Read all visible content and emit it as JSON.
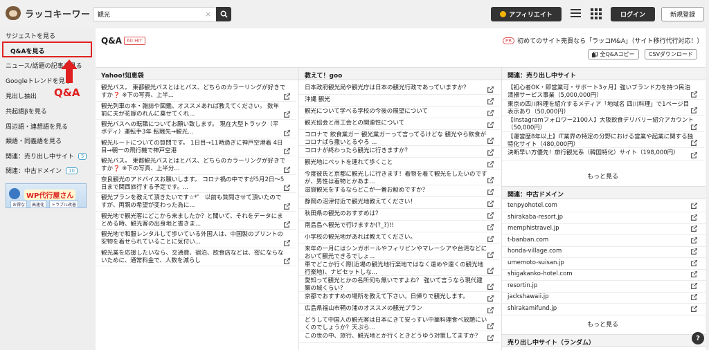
{
  "header": {
    "logo_text": "ラッコキーワード",
    "search_value": "観光",
    "search_clear": "×",
    "affiliate_label": "アフィリエイト",
    "login_label": "ログイン",
    "register_label": "新規登録"
  },
  "sidebar": {
    "items": [
      {
        "label": "サジェストを見る"
      },
      {
        "label": "Q&Aを見る"
      },
      {
        "label": "ニュース/話題の記事を見る"
      },
      {
        "label": "Googleトレンドを見る"
      },
      {
        "label": "見出し抽出"
      },
      {
        "label": "共起語βを見る"
      },
      {
        "label": "周辺語・連想語を見る"
      },
      {
        "label": "類語・同義語を見る"
      },
      {
        "label": "関連：売り出し中サイト",
        "badge": "5"
      },
      {
        "label": "関連：中古ドメイン",
        "badge": "10"
      }
    ],
    "annotation": "Q&A",
    "banner": {
      "title": "WP代行屋さん",
      "chips": [
        "お得な",
        "高速化",
        "トラブル改善"
      ]
    }
  },
  "main": {
    "title": "Q&A",
    "hit_badge": "60 HIT",
    "pr_badge": "PR",
    "pr_text": "初めてのサイト売買なら「ラッコM&A」（サイト移行代行対応！）",
    "copy_label": "全Q&Aコピー",
    "csv_label": "CSVダウンロード",
    "columns": [
      {
        "title": "Yahoo!知恵袋",
        "items": [
          [
            "観光バス。 東都観光バスとはとバス、どちらのカラーリングが好きで",
            "すか❓ ※下の写真、上半..."
          ],
          [
            "観光列車の本・雑誌や図鑑、オススメあれば教えてください。 数年",
            "前に夫が花嫁のれんに乗せてくれ..."
          ],
          [
            "観光バスへの転職についてお願い致します。 現在大型トラック（平",
            "ボディ）運転手3年 転職先→観光..."
          ],
          [
            "観光ルートについての質問です。 1日目→11時過ぎに神戸空港着 4日",
            "目→朝一の飛行機で神戸空港"
          ],
          [
            "観光バス。 東都観光バスとはとバス、どちらのカラーリングが好きで",
            "すか❓ ※下の写真、上半分..."
          ],
          [
            "奈良観光のアドバイスお願いします。 コロナ禍の中ですが5月2日〜5",
            "日まで関西旅行する予定です。..."
          ],
          [
            "観光プランを教えて頂きたいです☆*゜ 以前も質問させて頂いたので",
            "すが、両親の希望が変わった為に..."
          ],
          [
            "観光地で観光客にどこから来ましたか？と聞いて、それをデータにま",
            "とめる時、観光客の出身地と書きま..."
          ],
          [
            "観光地で和服レンタルして歩いている外国人は、中国製のプリントの",
            "安物を着せられていることに気付い..."
          ],
          [
            "観光業を応援したいなら、交通費、宿泊、飲食店などは、密にならな",
            "いために、通常料金で、人数を減らし"
          ]
        ]
      },
      {
        "title": "教えて！goo",
        "items": [
          [
            "日本政府観光局や観光庁は日本の観光行政であっていますか？"
          ],
          [
            "沖縄 観光"
          ],
          [
            "観光について学べる学校の今後の展望について"
          ],
          [
            "観光協会と商工会との関連性について"
          ],
          [
            "コロナで 飲食業ガー 観光業ガーって言ってるけどな 観光やら飲食が",
            "コロナばら撒いとるやろ ..."
          ],
          [
            "コロナが終わったら観光に行きますか？"
          ],
          [
            "観光地にペットを連れて歩くこと"
          ],
          [
            "今度彼氏と京都に観光しに行きます！着物を着て観光をしたいのです",
            "が、男性は着物とかあま..."
          ],
          [
            "滋賀観光をするならどこが一番お勧めですか？"
          ],
          [
            "静岡の沼津付近で観光地教えてください！"
          ],
          [
            "秋田県の観光のおすすめは？"
          ],
          [
            "南島島へ観光で行けますか(?_?)!!"
          ],
          [
            "小学校の観光地があれば教えてください。"
          ],
          [
            "来年の一月にはシンガポールやフィリピンやマレーシアや台湾などに",
            "おいて観光できるでしょ..."
          ],
          [
            "車でどこか行く際(近場の観光地行楽地ではなく遠めや遠くの観光地",
            "行楽地)、ナビセットしな..."
          ],
          [
            "愛知って観光とかの名所何も無いですよね？ 強いて言うなら現代建",
            "築の城くらい？"
          ],
          [
            "京都でおすすめの場所を教えて下さい。日帰りで観光します。"
          ],
          [
            "広島県福山市鞆の浦のオススメの観光プラン"
          ],
          [
            "どうして中国人の観光客は日本にきて安っすい中華料理食べ放題にい",
            "くのでしょうか？天ぷら..."
          ],
          [
            "この世の中、旅行、観光地とか行くときどうゆう対策してますか？"
          ]
        ]
      },
      {
        "title": "関連：売り出し中サイト",
        "items": [
          [
            "【初心者OK・即営業可・サポート3ヶ月】強いブランド力を持つ民泊",
            "清掃サービス事業（5,000,000円）"
          ],
          [
            "東京の四川料理を紹介するメディア「地域名 四川料理」で1ページ目",
            "表示あり（50,000円）"
          ],
          [
            "【Instagramフォロワー2100人】大阪飲食デリバリー紹介アカウント",
            "（50,000円）"
          ],
          [
            "【運営歴8年以上】IT業界の特定の分野における営業や起業に関する独",
            "特化サイト（480,000円）"
          ],
          [
            "決断早い方優先！旅行観光系（韓国特化）サイト（198,000円）"
          ]
        ],
        "more_label": "もっと見る"
      }
    ],
    "domains": {
      "title": "関連：中古ドメイン",
      "items": [
        "tenpyohotel.com",
        "shirakaba-resort.jp",
        "memphistravel.jp",
        "t-banban.com",
        "honda-village.com",
        "umemoto-suisan.jp",
        "shigakanko-hotel.com",
        "resortin.jp",
        "jackshawaii.jp",
        "shirakamifund.jp"
      ],
      "more_label": "もっと見る"
    },
    "random_title": "売り出し中サイト（ランダム）"
  },
  "help_label": "?"
}
